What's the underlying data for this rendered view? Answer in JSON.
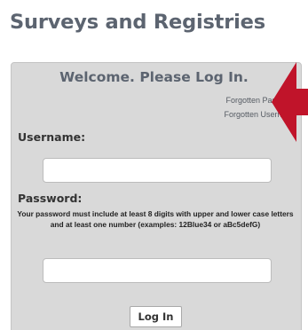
{
  "header": {
    "title": "Surveys and Registries"
  },
  "login": {
    "welcome": "Welcome. Please Log In.",
    "forgot_password": "Forgotten Password",
    "forgot_username": "Forgotten Username",
    "username_label": "Username:",
    "username_value": "",
    "password_label": "Password:",
    "password_hint": "Your password must include at least 8 digits with upper and lower case letters and at least one number (examples: 12Blue34 or aBc5defG)",
    "password_value": "",
    "login_button": "Log In"
  },
  "colors": {
    "panel": "#d9d9d9",
    "title": "#5c6470",
    "arrow": "#c0142a"
  },
  "icons": {
    "pointer": "red-arrow-icon"
  }
}
